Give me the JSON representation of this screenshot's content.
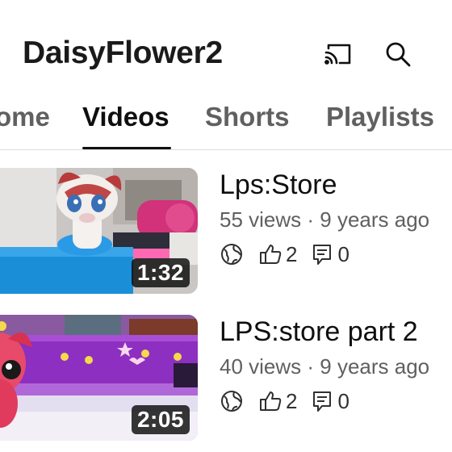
{
  "header": {
    "channel_title": "DaisyFlower2",
    "cast_icon": "cast-icon",
    "search_icon": "search-icon"
  },
  "tabs": [
    {
      "label": "ome",
      "active": false
    },
    {
      "label": "Videos",
      "active": true
    },
    {
      "label": "Shorts",
      "active": false
    },
    {
      "label": "Playlists",
      "active": false
    }
  ],
  "videos": [
    {
      "title": "Lps:Store",
      "duration": "1:32",
      "meta": "55 views · 9 years ago",
      "likes": "2",
      "comments": "0",
      "visibility_icon": "globe-icon"
    },
    {
      "title": "LPS:store part 2",
      "duration": "2:05",
      "meta": "40 views · 9 years ago",
      "likes": "2",
      "comments": "0",
      "visibility_icon": "globe-icon"
    }
  ],
  "colors": {
    "text_primary": "#0f0f0f",
    "text_secondary": "#606060",
    "divider": "#dcdcdc"
  }
}
